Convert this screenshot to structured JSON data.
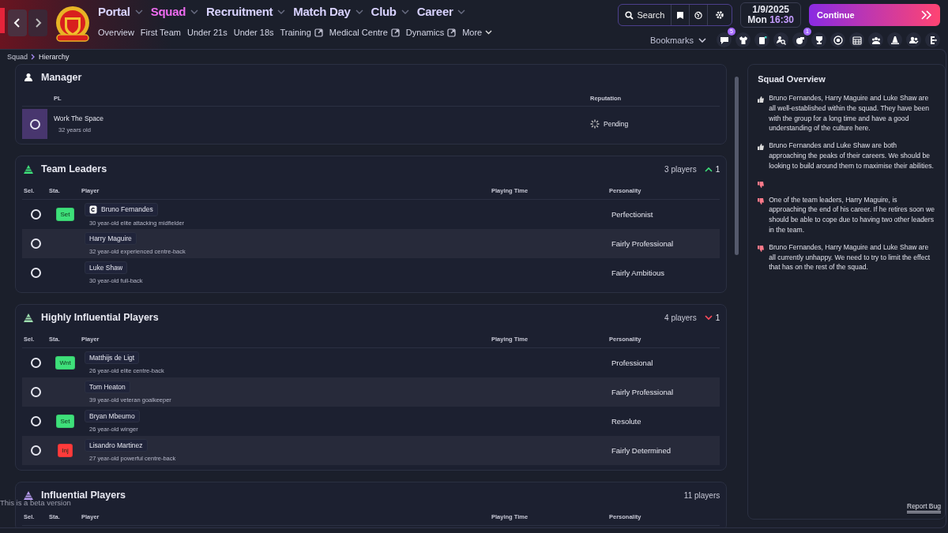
{
  "nav": {
    "menu": [
      {
        "label": "Portal",
        "selected": false
      },
      {
        "label": "Squad",
        "selected": true
      },
      {
        "label": "Recruitment",
        "selected": false
      },
      {
        "label": "Match Day",
        "selected": false
      },
      {
        "label": "Club",
        "selected": false
      },
      {
        "label": "Career",
        "selected": false
      }
    ],
    "submenu": [
      {
        "label": "Overview",
        "kind": "plain"
      },
      {
        "label": "First Team",
        "kind": "plain"
      },
      {
        "label": "Under 21s",
        "kind": "plain"
      },
      {
        "label": "Under 18s",
        "kind": "plain"
      },
      {
        "label": "Training",
        "kind": "external"
      },
      {
        "label": "Medical Centre",
        "kind": "external"
      },
      {
        "label": "Dynamics",
        "kind": "external"
      },
      {
        "label": "More",
        "kind": "dropdown"
      }
    ]
  },
  "toolbar": {
    "search": "Search",
    "date": "1/9/2025",
    "day": "Mon",
    "time": "16:30",
    "continue": "Continue",
    "bookmarks": "Bookmarks",
    "badges": [
      "5",
      "1"
    ]
  },
  "breadcrumb": [
    "Squad",
    "Hierarchy"
  ],
  "manager": {
    "title": "Manager",
    "columns": [
      "PL",
      "Reputation"
    ],
    "name": "Work The Space",
    "age": "32 years old",
    "reputation": "Pending",
    "selected": false
  },
  "sections": [
    {
      "title": "Team Leaders",
      "color": "#3ee07a",
      "count": "3 players",
      "trend": {
        "kind": "up",
        "value": "1"
      },
      "columns": [
        "Sel.",
        "Sta.",
        "Player",
        "Playing Time",
        "Personality"
      ],
      "rows": [
        {
          "selected": false,
          "status": {
            "label": "Set",
            "color": "#3ee07a"
          },
          "captain": true,
          "name": "Bruno Fernandes",
          "desc": "30 year-old elite attacking midfielder",
          "personality": "Perfectionist"
        },
        {
          "selected": false,
          "captain": false,
          "name": "Harry Maguire",
          "desc": "32 year-old experienced centre-back",
          "personality": "Fairly Professional"
        },
        {
          "selected": false,
          "captain": false,
          "name": "Luke Shaw",
          "desc": "30 year-old full-back",
          "personality": "Fairly Ambitious"
        }
      ]
    },
    {
      "title": "Highly Influential Players",
      "color": "#9fe0b0",
      "count": "4 players",
      "trend": {
        "kind": "down",
        "value": "1"
      },
      "columns": [
        "Sel.",
        "Sta.",
        "Player",
        "Playing Time",
        "Personality"
      ],
      "rows": [
        {
          "selected": false,
          "status": {
            "label": "Wnt",
            "color": "#3ee07a"
          },
          "captain": false,
          "name": "Matthijs de Ligt",
          "desc": "26 year-old elite centre-back",
          "personality": "Professional"
        },
        {
          "selected": false,
          "captain": false,
          "name": "Tom Heaton",
          "desc": "39 year-old veteran goalkeeper",
          "personality": "Fairly Professional"
        },
        {
          "selected": false,
          "status": {
            "label": "Set",
            "color": "#3ee07a"
          },
          "captain": false,
          "name": "Bryan Mbeumo",
          "desc": "26 year-old winger",
          "personality": "Resolute"
        },
        {
          "selected": false,
          "status": {
            "label": "Inj",
            "color": "#ff3b3b"
          },
          "captain": false,
          "name": "Lisandro Martinez",
          "desc": "27 year-old powerful centre-back",
          "personality": "Fairly Determined"
        }
      ]
    },
    {
      "title": "Influential Players",
      "color": "#b79cf0",
      "count": "11 players",
      "columns": [
        "Sel.",
        "Sta.",
        "Player",
        "Playing Time",
        "Personality"
      ]
    }
  ],
  "overview": {
    "title": "Squad Overview",
    "items": [
      {
        "kind": "positive",
        "text": "Bruno Fernandes, Harry Maguire and Luke Shaw are all well-established within the squad. They have been with the group for a long time and have a good understanding of the culture here."
      },
      {
        "kind": "positive",
        "text": "Bruno Fernandes and Luke Shaw are both approaching the peaks of their careers. We should be looking to build around them to maximise their abilities."
      },
      {
        "kind": "negative"
      },
      {
        "kind": "negative",
        "text": "One of the team leaders, Harry Maguire, is approaching the end of his career. If he retires soon we should be able to cope due to having two other leaders in the team."
      },
      {
        "kind": "negative",
        "text": "Bruno Fernandes, Harry Maguire and Luke Shaw are all currently unhappy. We need to try to limit the effect that has on the rest of the squad."
      }
    ]
  },
  "beta_notice": "This is a beta version",
  "report_bug": "Report Bug"
}
